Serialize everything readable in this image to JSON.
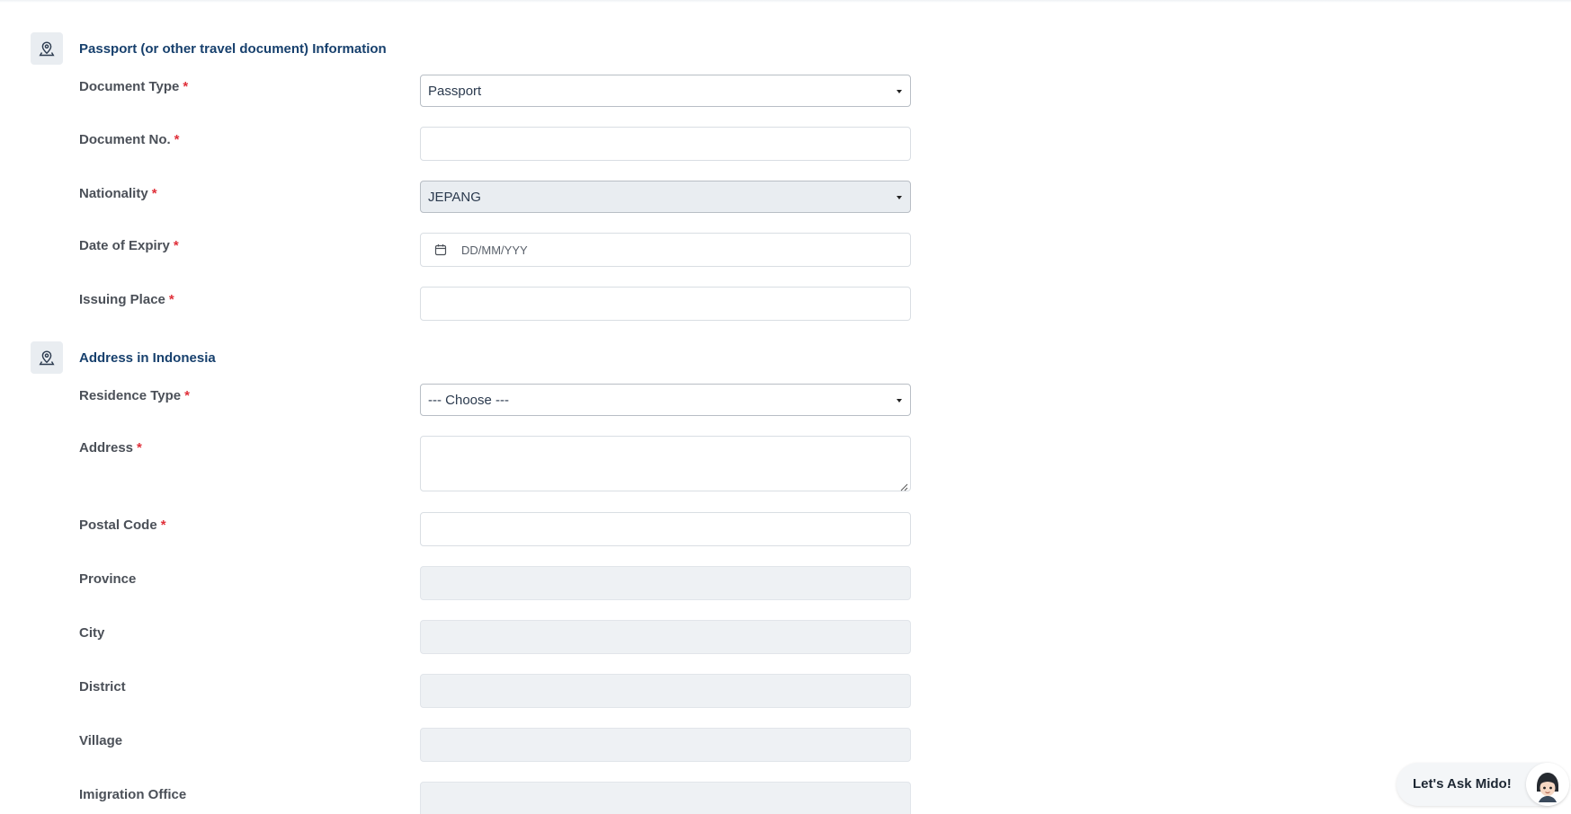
{
  "sections": {
    "passport": {
      "title": "Passport (or other travel document) Information",
      "icon": "location-pin-icon"
    },
    "address": {
      "title": "Address in Indonesia",
      "icon": "location-pin-icon"
    }
  },
  "required_marker": "*",
  "fields": {
    "document_type": {
      "label": "Document Type",
      "value": "Passport"
    },
    "document_no": {
      "label": "Document No.",
      "value": ""
    },
    "nationality": {
      "label": "Nationality",
      "value": "JEPANG"
    },
    "date_of_expiry": {
      "label": "Date of Expiry",
      "placeholder": "DD/MM/YYY",
      "icon": "calendar-icon"
    },
    "issuing_place": {
      "label": "Issuing Place",
      "value": ""
    },
    "residence_type": {
      "label": "Residence Type",
      "value": "--- Choose ---"
    },
    "address": {
      "label": "Address",
      "value": ""
    },
    "postal_code": {
      "label": "Postal Code",
      "value": ""
    },
    "province": {
      "label": "Province",
      "value": ""
    },
    "city": {
      "label": "City",
      "value": ""
    },
    "district": {
      "label": "District",
      "value": ""
    },
    "village": {
      "label": "Village",
      "value": ""
    },
    "imigration_office": {
      "label": "Imigration Office",
      "value": ""
    }
  },
  "assistant": {
    "label": "Let's Ask Mido!",
    "icon": "mido-avatar-icon"
  },
  "colors": {
    "accent": "#17406d",
    "required": "#e0303a",
    "disabled_bg": "#eef1f4"
  }
}
